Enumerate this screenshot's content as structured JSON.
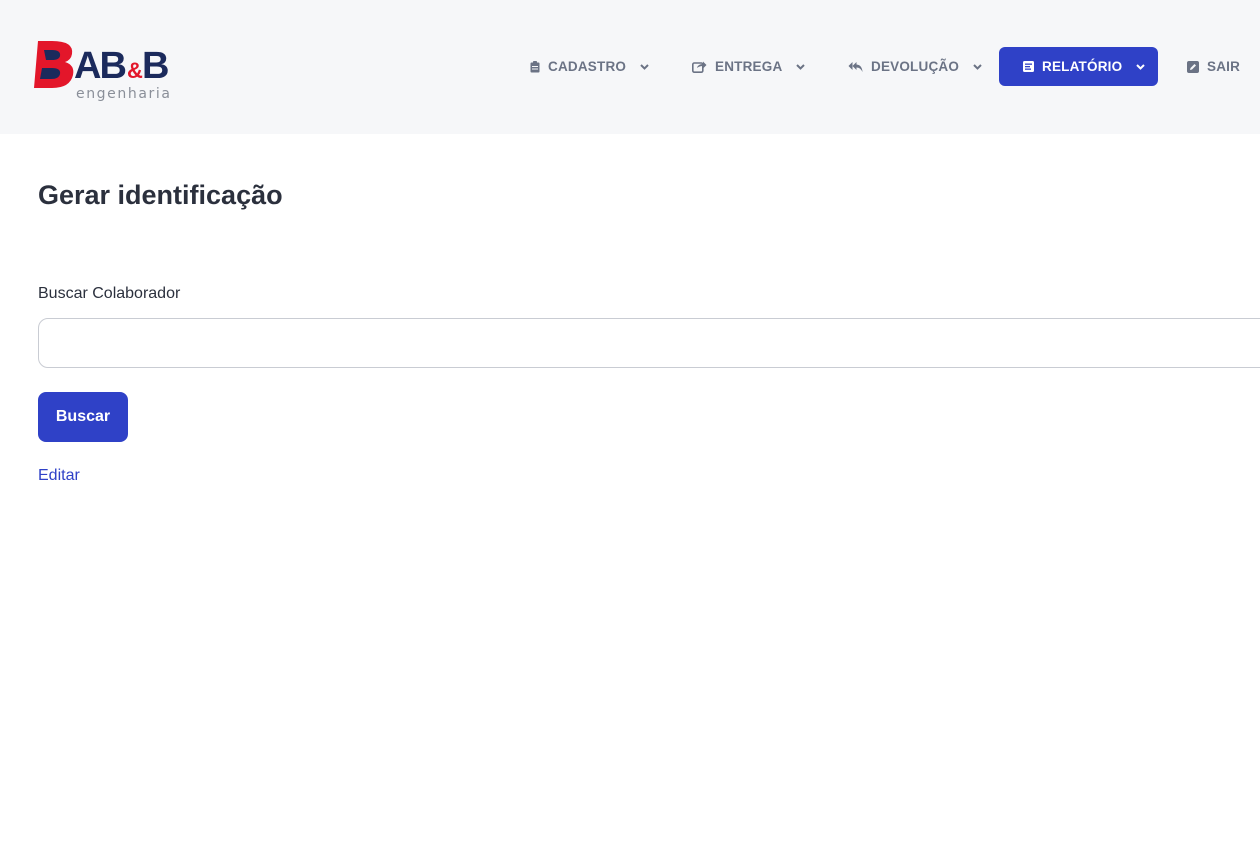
{
  "brand": {
    "name": "AB&B",
    "tagline": "engenharia",
    "colors": {
      "red": "#e3162a",
      "navy": "#1b2a5c",
      "gray": "#8a8f99"
    }
  },
  "nav": {
    "items": [
      {
        "label": "CADASTRO",
        "icon": "clipboard-icon",
        "has_dropdown": true
      },
      {
        "label": "ENTREGA",
        "icon": "share-icon",
        "has_dropdown": true
      },
      {
        "label": "DEVOLUÇÃO",
        "icon": "reply-all-icon",
        "has_dropdown": true
      },
      {
        "label": "RELATÓRIO",
        "icon": "report-icon",
        "has_dropdown": true,
        "active": true
      },
      {
        "label": "SAIR",
        "icon": "edit-square-icon",
        "has_dropdown": false
      }
    ],
    "accent": "#2f41c7"
  },
  "main": {
    "title": "Gerar identificação",
    "search": {
      "label": "Buscar Colaborador",
      "value": "",
      "placeholder": ""
    },
    "search_button": "Buscar",
    "edit_link": "Editar"
  }
}
